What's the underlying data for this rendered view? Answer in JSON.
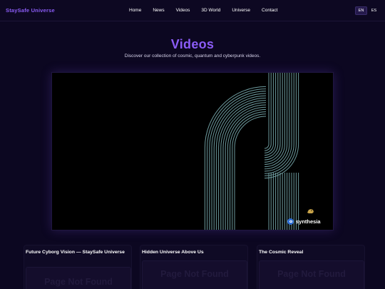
{
  "header": {
    "brand": "StaySafe Universe",
    "nav": [
      "Home",
      "News",
      "Videos",
      "3D World",
      "Universe",
      "Contact"
    ],
    "languages": [
      {
        "code": "EN",
        "active": true
      },
      {
        "code": "ES",
        "active": false
      }
    ]
  },
  "hero": {
    "title": "Videos",
    "subtitle": "Discover our collection of cosmic, quantum and cyberpunk videos."
  },
  "player": {
    "watermark": "synthesia"
  },
  "cards": [
    {
      "title": "Future Cyborg Vision — StaySafe Universe",
      "embed_text": "Page Not Found"
    },
    {
      "title": "Hidden Universe Above Us",
      "embed_text": "Page Not Found"
    },
    {
      "title": "The Cosmic Reveal",
      "embed_text": "Page Not Found"
    }
  ],
  "colors": {
    "background": "#0c0721",
    "accent": "#8b5cf6",
    "stripes": "#7fb4b8"
  }
}
